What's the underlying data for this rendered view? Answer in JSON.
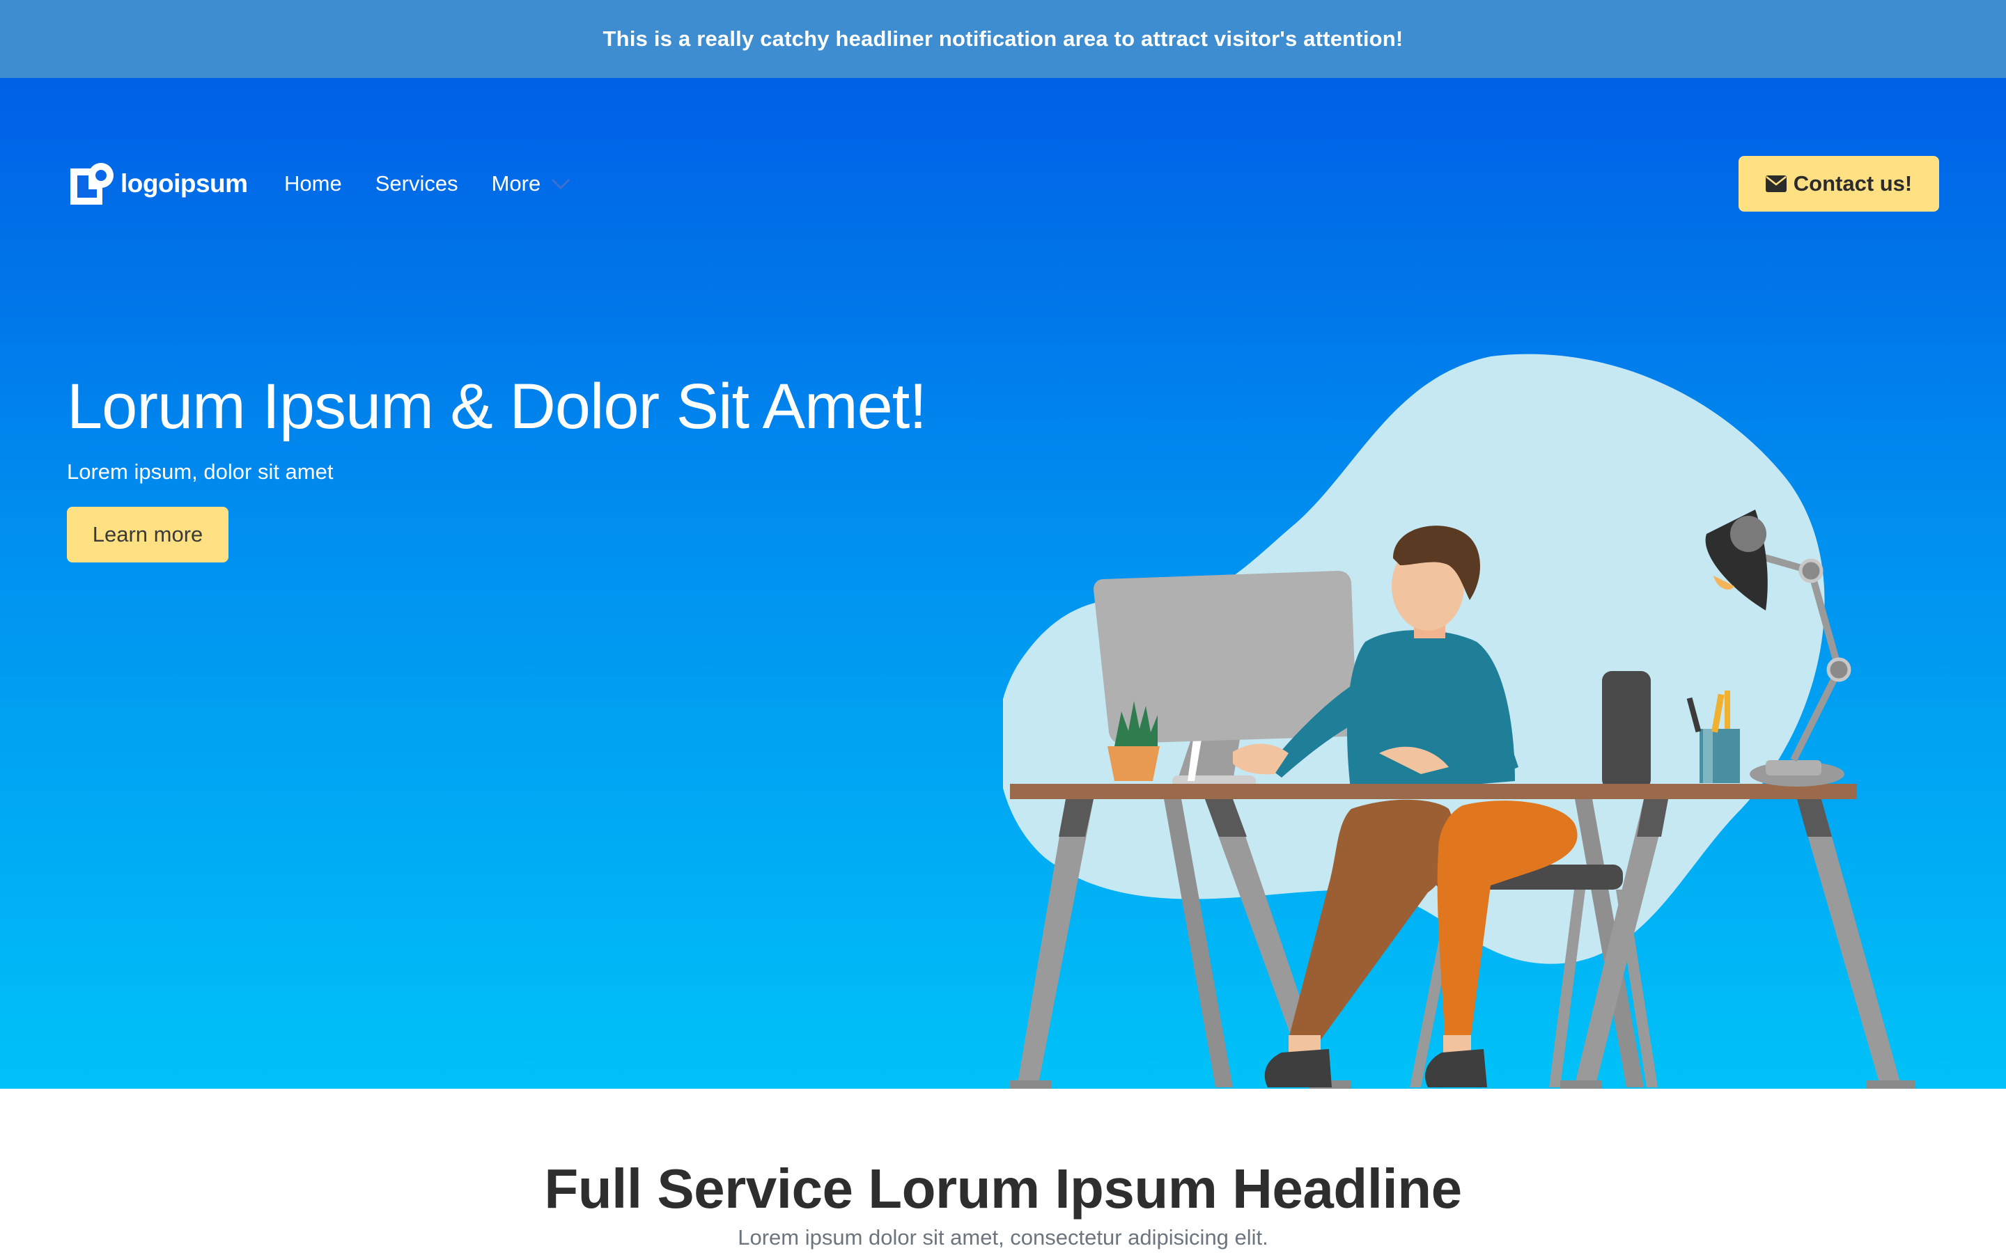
{
  "notification": {
    "text": "This is a really catchy headliner notification area to attract visitor's attention!"
  },
  "nav": {
    "logo_text": "logoipsum",
    "links": [
      "Home",
      "Services",
      "More"
    ],
    "contact_label": "Contact us!"
  },
  "hero": {
    "title": "Lorum Ipsum & Dolor Sit Amet!",
    "subtitle": "Lorem ipsum, dolor sit amet",
    "cta_label": "Learn more"
  },
  "section": {
    "title": "Full Service Lorum Ipsum Headline",
    "subtitle": "Lorem ipsum dolor sit amet, consectetur adipisicing elit."
  },
  "colors": {
    "notification_bg": "#3d8dd0",
    "hero_gradient_top": "#0060e6",
    "hero_gradient_bottom": "#00c2f8",
    "button_yellow": "#ffe082"
  },
  "icons": [
    "logo-mark-icon",
    "chevron-down-icon",
    "envelope-icon"
  ]
}
